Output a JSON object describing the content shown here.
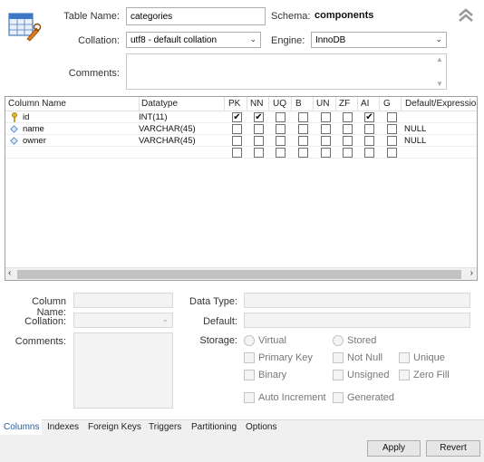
{
  "header": {
    "table_name_label": "Table Name:",
    "table_name_value": "categories",
    "schema_label": "Schema:",
    "schema_value": "components",
    "collation_label": "Collation:",
    "collation_value": "utf8 - default collation",
    "engine_label": "Engine:",
    "engine_value": "InnoDB",
    "comments_label": "Comments:",
    "comments_value": "",
    "collapse_icon": "double-chevron-up-icon",
    "table_icon": "table-wrench-icon"
  },
  "grid": {
    "headers": [
      "Column Name",
      "Datatype",
      "PK",
      "NN",
      "UQ",
      "B",
      "UN",
      "ZF",
      "AI",
      "G",
      "Default/Expression"
    ],
    "rows": [
      {
        "name": "id",
        "datatype": "INT(11)",
        "flags": [
          true,
          true,
          false,
          false,
          false,
          false,
          true,
          false
        ],
        "default": "",
        "icon": "primary-key-icon"
      },
      {
        "name": "name",
        "datatype": "VARCHAR(45)",
        "flags": [
          false,
          false,
          false,
          false,
          false,
          false,
          false,
          false
        ],
        "default": "NULL",
        "icon": "column-diamond-icon"
      },
      {
        "name": "owner",
        "datatype": "VARCHAR(45)",
        "flags": [
          false,
          false,
          false,
          false,
          false,
          false,
          false,
          false
        ],
        "default": "NULL",
        "icon": "column-diamond-icon"
      },
      {
        "name": "",
        "datatype": "",
        "flags": [
          false,
          false,
          false,
          false,
          false,
          false,
          false,
          false
        ],
        "default": "",
        "icon": ""
      }
    ]
  },
  "details": {
    "column_name_label": "Column Name:",
    "collation_label": "Collation:",
    "comments_label": "Comments:",
    "data_type_label": "Data Type:",
    "default_label": "Default:",
    "storage_label": "Storage:",
    "virtual_label": "Virtual",
    "stored_label": "Stored",
    "primary_key_label": "Primary Key",
    "not_null_label": "Not Null",
    "unique_label": "Unique",
    "binary_label": "Binary",
    "unsigned_label": "Unsigned",
    "zero_fill_label": "Zero Fill",
    "auto_increment_label": "Auto Increment",
    "generated_label": "Generated"
  },
  "tabs": [
    "Columns",
    "Indexes",
    "Foreign Keys",
    "Triggers",
    "Partitioning",
    "Options"
  ],
  "buttons": {
    "apply": "Apply",
    "revert": "Revert"
  },
  "colors": {
    "active_tab": "#1c5fb0",
    "scrollbar": "#c2c2c2",
    "bottom_bar": "#f0f0f0"
  }
}
